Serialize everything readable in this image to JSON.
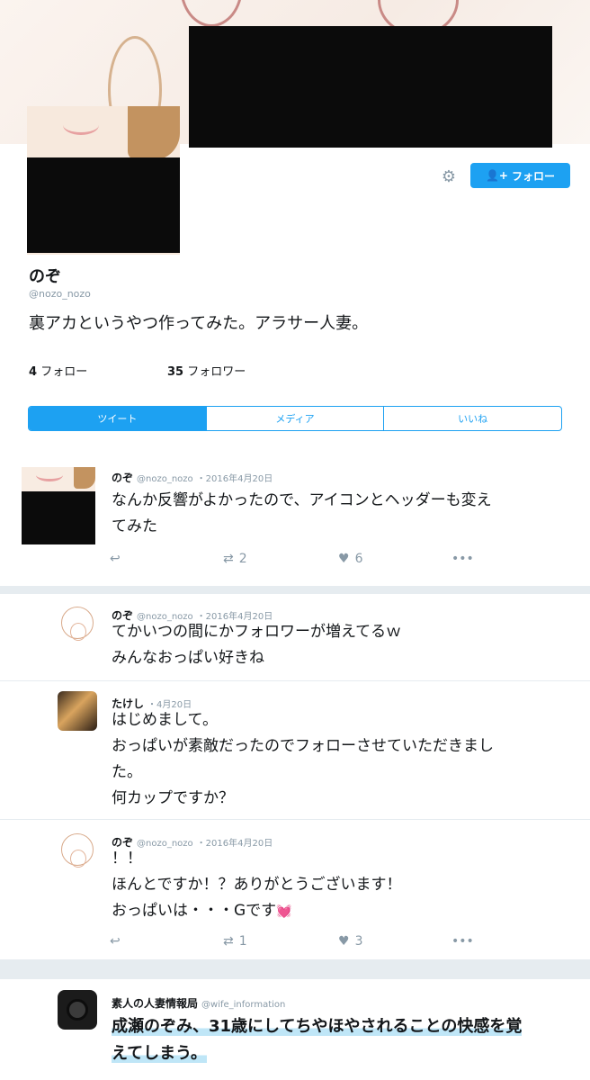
{
  "profile": {
    "name": "のぞ",
    "handle": "@nozo_nozo",
    "bio": "裏アカというやつ作ってみた。アラサー人妻。",
    "follow_label": "フォロー",
    "following_count": "4",
    "following_label": "フォロー",
    "followers_count": "35",
    "followers_label": "フォロワー"
  },
  "tabs": [
    {
      "label": "ツイート",
      "active": true
    },
    {
      "label": "メディア",
      "active": false
    },
    {
      "label": "いいね",
      "active": false
    }
  ],
  "tweets": [
    {
      "name": "のぞ",
      "handle": "@nozo_nozo",
      "date": "・2016年4月20日",
      "lines": [
        "なんか反響がよかったので、アイコンとヘッダーも変え",
        "てみた"
      ],
      "retweets": "2",
      "likes": "6"
    },
    {
      "name": "のぞ",
      "handle": "@nozo_nozo",
      "date": "・2016年4月20日",
      "lines": [
        "てかいつの間にかフォロワーが増えてるｗ",
        "みんなおっぱい好きね"
      ]
    },
    {
      "name": "たけし",
      "handle": "",
      "date": "・4月20日",
      "lines": [
        "はじめまして。",
        "おっぱいが素敵だったのでフォローさせていただきまし",
        "た。",
        "何カップですか？"
      ]
    },
    {
      "name": "のぞ",
      "handle": "@nozo_nozo",
      "date": "・2016年4月20日",
      "lines": [
        "！！",
        "ほんとですか！？ありがとうございます！",
        "おっぱいは・・・Gです"
      ],
      "heart_emoji": "💓",
      "retweets": "1",
      "likes": "3"
    },
    {
      "name": "素人の人妻情報局",
      "handle": "@wife_information",
      "date": "",
      "lines": [
        "成瀬のぞみ、31歳にしてちやほやされることの快感を覚",
        "えてしまう。"
      ]
    }
  ],
  "icons": {
    "gear": "gear-icon",
    "follow": "user-plus-icon",
    "reply": "reply-icon",
    "retweet": "retweet-icon",
    "like": "heart-icon",
    "more": "more-icon"
  },
  "colors": {
    "accent": "#1da1f2",
    "muted": "#8899a6",
    "separator": "#e6ecf0"
  }
}
